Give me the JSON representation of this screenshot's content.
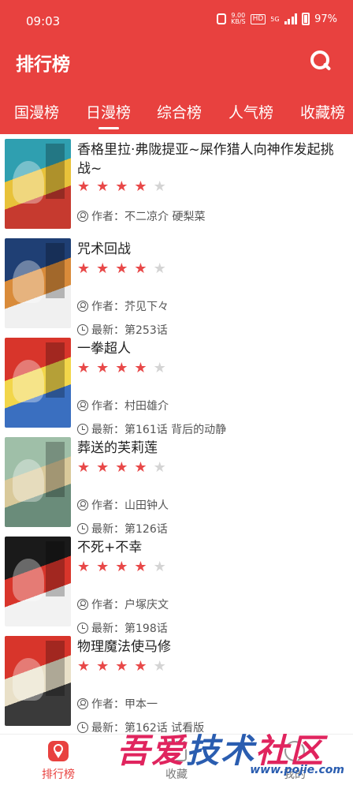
{
  "status_bar": {
    "time": "09:03",
    "net_speed_value": "9.00",
    "net_speed_unit": "KB/S",
    "hd": "HD",
    "network": "5G",
    "battery": "97%"
  },
  "header": {
    "title": "排行榜"
  },
  "tabs": [
    {
      "label": "国漫榜",
      "active": false
    },
    {
      "label": "日漫榜",
      "active": true
    },
    {
      "label": "综合榜",
      "active": false
    },
    {
      "label": "人气榜",
      "active": false
    },
    {
      "label": "收藏榜",
      "active": false
    }
  ],
  "author_prefix": "作者：",
  "latest_prefix": "最新：",
  "items": [
    {
      "title": "香格里拉·弗陇提亚~屎作猎人向神作发起挑战~",
      "rating": 4,
      "author": "不二凉介 硬梨菜",
      "latest": "",
      "cover_colors": [
        "#2f9fb0",
        "#e8c23a",
        "#c63a2f"
      ]
    },
    {
      "title": "咒术回战",
      "rating": 4,
      "author": "芥见下々",
      "latest": "第253话",
      "cover_colors": [
        "#1f3f74",
        "#d98b3a",
        "#f0f0f0"
      ]
    },
    {
      "title": "一拳超人",
      "rating": 4,
      "author": "村田雄介",
      "latest": "第161话 背后的动静",
      "cover_colors": [
        "#d8352b",
        "#f2d64a",
        "#3a6fc0"
      ]
    },
    {
      "title": "葬送的芙莉莲",
      "rating": 4,
      "author": "山田钟人",
      "latest": "第126话",
      "cover_colors": [
        "#9fbfa8",
        "#d9c99a",
        "#6a8c7a"
      ]
    },
    {
      "title": "不死+不幸",
      "rating": 4,
      "author": "户塚庆文",
      "latest": "第198话",
      "cover_colors": [
        "#1a1a1a",
        "#d8352b",
        "#f2f2f2"
      ]
    },
    {
      "title": "物理魔法使马修",
      "rating": 4,
      "author": "甲本一",
      "latest": "第162话 试看版",
      "cover_colors": [
        "#d8352b",
        "#e9e0c8",
        "#3a3a3a"
      ]
    }
  ],
  "bottom_nav": [
    {
      "label": "排行榜",
      "icon": "ranking-icon",
      "active": true
    },
    {
      "label": "收藏",
      "icon": "favorites-icon",
      "active": false
    },
    {
      "label": "我的",
      "icon": "profile-icon",
      "active": false
    }
  ],
  "watermark": {
    "text_part1": "吾爱",
    "text_part2": "技术",
    "text_part3": "社区",
    "url": "www.pojie.com"
  },
  "colors": {
    "accent": "#e8413f",
    "star_on": "#e84848",
    "star_off": "#d4d4d4"
  }
}
